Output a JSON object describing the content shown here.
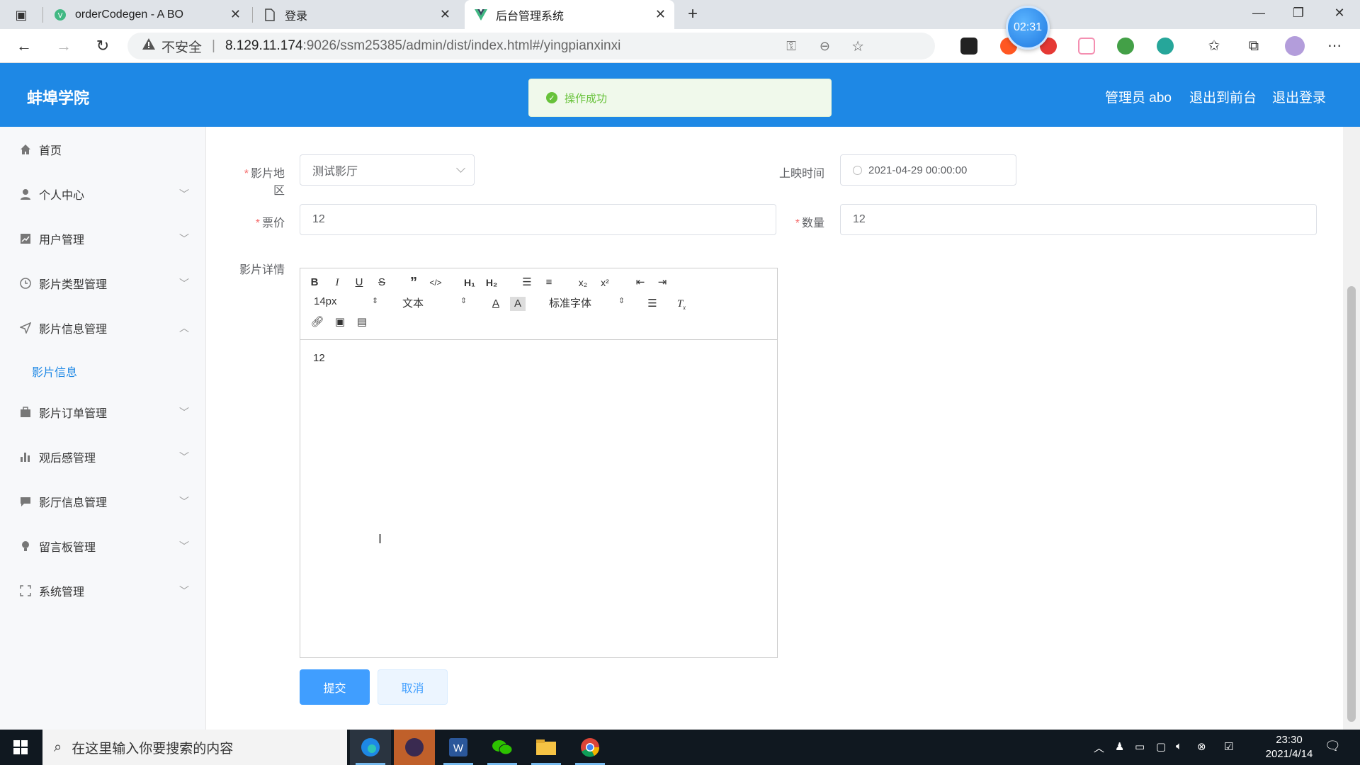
{
  "browser": {
    "tabs": [
      {
        "title": "orderCodegen - A BO"
      },
      {
        "title": "登录"
      },
      {
        "title": "后台管理系统"
      }
    ],
    "address": {
      "security_label": "不安全",
      "url_host": "8.129.11.174",
      "url_rest": ":9026/ssm25385/admin/dist/index.html#/yingpianxinxi"
    },
    "timer": "02:31"
  },
  "header": {
    "brand": "蚌埠学院",
    "toast": "操作成功",
    "admin_label": "管理员 abo",
    "to_front_label": "退出到前台",
    "logout_label": "退出登录"
  },
  "sidebar": {
    "items": [
      {
        "label": "首页",
        "icon": "home-icon"
      },
      {
        "label": "个人中心",
        "icon": "user-icon"
      },
      {
        "label": "用户管理",
        "icon": "chart-icon"
      },
      {
        "label": "影片类型管理",
        "icon": "clock-icon"
      },
      {
        "label": "影片信息管理",
        "icon": "send-icon"
      },
      {
        "label": "影片订单管理",
        "icon": "briefcase-icon"
      },
      {
        "label": "观后感管理",
        "icon": "bar-chart-icon"
      },
      {
        "label": "影厅信息管理",
        "icon": "message-icon"
      },
      {
        "label": "留言板管理",
        "icon": "bulb-icon"
      },
      {
        "label": "系统管理",
        "icon": "fullscreen-icon"
      }
    ],
    "active_sub": "影片信息"
  },
  "form": {
    "region_label": "影片地区",
    "region_value": "测试影厅",
    "date_label": "上映时间",
    "date_value": "2021-04-29 00:00:00",
    "price_label": "票价",
    "price_value": "12",
    "qty_label": "数量",
    "qty_value": "12",
    "detail_label": "影片详情",
    "editor": {
      "font_size": "14px",
      "block_type": "文本",
      "font_family": "标准字体",
      "content": "12"
    },
    "submit_label": "提交",
    "cancel_label": "取消"
  },
  "taskbar": {
    "search_placeholder": "在这里输入你要搜索的内容",
    "time": "23:30",
    "date": "2021/4/14"
  },
  "colors": {
    "header_bg": "#1e88e5",
    "primary": "#409eff",
    "success": "#67c23a"
  }
}
